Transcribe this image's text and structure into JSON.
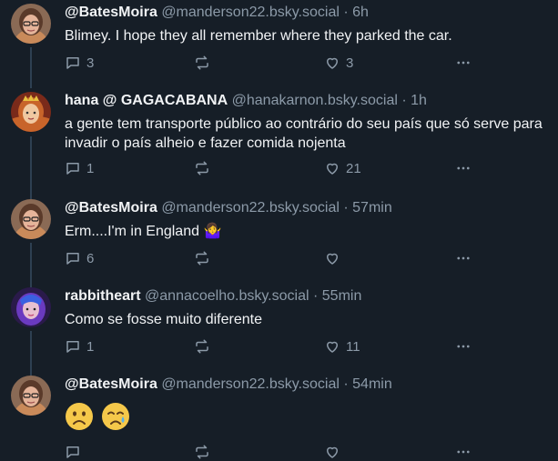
{
  "posts": [
    {
      "author": "@BatesMoira",
      "handle": "@manderson22.bsky.social",
      "separator": "·",
      "time": "6h",
      "text": "Blimey. I hope they all remember where they parked the car.",
      "reply_count": "3",
      "repost_count": "",
      "like_count": "3",
      "avatar_icon": "woman-with-glasses-avatar"
    },
    {
      "author": "hana @ GAGACABANA",
      "handle": "@hanakarnon.bsky.social",
      "separator": "·",
      "time": "1h",
      "text": "a gente tem transporte público ao contrário do seu país que só serve para invadir o país alheio e fazer comida nojenta",
      "reply_count": "1",
      "repost_count": "",
      "like_count": "21",
      "avatar_icon": "illustrated-crowned-avatar"
    },
    {
      "author": "@BatesMoira",
      "handle": "@manderson22.bsky.social",
      "separator": "·",
      "time": "57min",
      "text": "Erm....I'm in England 🤷‍♀️",
      "reply_count": "6",
      "repost_count": "",
      "like_count": "",
      "avatar_icon": "woman-with-glasses-avatar"
    },
    {
      "author": "rabbitheart",
      "handle": "@annacoelho.bsky.social",
      "separator": "·",
      "time": "55min",
      "text": "Como se fosse muito diferente",
      "reply_count": "1",
      "repost_count": "",
      "like_count": "11",
      "avatar_icon": "purple-hair-avatar"
    },
    {
      "author": "@BatesMoira",
      "handle": "@manderson22.bsky.social",
      "separator": "·",
      "time": "54min",
      "text": "",
      "emojis": [
        "slightly-frowning-face-emoji",
        "crying-face-emoji"
      ],
      "reply_count": "",
      "repost_count": "",
      "like_count": "",
      "avatar_icon": "woman-with-glasses-avatar"
    }
  ],
  "icons": {
    "reply": "reply-icon",
    "repost": "repost-icon",
    "like": "heart-icon",
    "more": "more-options-icon"
  },
  "colors": {
    "background": "#161e27",
    "text": "#f1f3f5",
    "muted": "#8c9aa8",
    "thread_line": "#2e4052"
  }
}
